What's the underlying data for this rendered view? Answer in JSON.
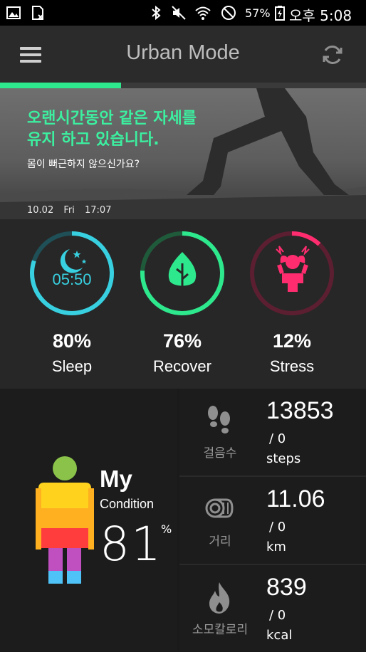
{
  "status_bar": {
    "battery": "57%",
    "time": "오후 5:08",
    "icons": [
      "gallery-icon",
      "sim-card-icon",
      "bluetooth-icon",
      "mute-icon",
      "wifi-icon",
      "block-icon",
      "battery-charging-icon"
    ]
  },
  "app_bar": {
    "title": "Urban Mode",
    "menu_icon": "hamburger-menu-icon",
    "sync_icon": "sync-icon"
  },
  "progress": {
    "fraction": 0.33,
    "color": "#2ee88d"
  },
  "banner": {
    "headline_line1": "오랜시간동안 같은 자세를",
    "headline_line2": "유지 하고 있습니다.",
    "subtext": "몸이 뻐근하지 않으신가요?",
    "date": "10.02",
    "day": "Fri",
    "time": "17:07"
  },
  "stats": [
    {
      "label": "Sleep",
      "value": "80%",
      "ring_fraction": 0.8,
      "color": "#38d0e0",
      "icon": "moon-stars-icon",
      "inner_text": "05:50"
    },
    {
      "label": "Recover",
      "value": "76%",
      "ring_fraction": 0.76,
      "color": "#2ee88d",
      "icon": "leaf-icon"
    },
    {
      "label": "Stress",
      "value": "12%",
      "ring_fraction": 0.12,
      "color": "#ff2d6f",
      "icon": "stressed-person-icon"
    }
  ],
  "condition": {
    "title": "My",
    "label": "Condition",
    "value": "81",
    "unit": "%"
  },
  "metrics": [
    {
      "name": "걸음수",
      "value": "13853",
      "goal": "/ 0",
      "unit": "steps",
      "icon": "footprints-icon"
    },
    {
      "name": "거리",
      "value": "11.06",
      "goal": "/ 0",
      "unit": "km",
      "icon": "distance-roll-icon"
    },
    {
      "name": "소모칼로리",
      "value": "839",
      "goal": "/ 0",
      "unit": "kcal",
      "icon": "flame-icon"
    }
  ]
}
